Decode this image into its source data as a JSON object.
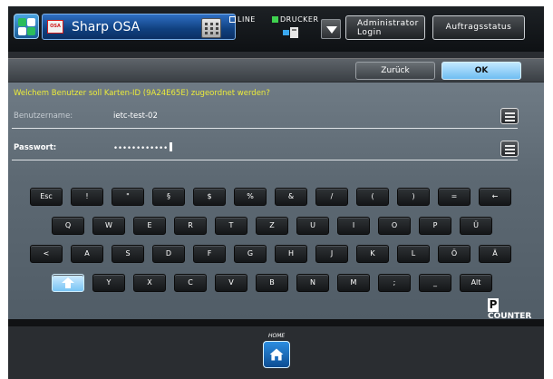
{
  "header": {
    "app_title": "Sharp OSA",
    "osa_badge": "OSA",
    "status_line": "LINE",
    "status_printer": "DRUCKER",
    "admin_button": [
      "Administrator",
      "Login"
    ],
    "job_status_button": "Auftragsstatus"
  },
  "toolbar": {
    "back_label": "Zurück",
    "ok_label": "OK"
  },
  "form": {
    "question": "Welchem Benutzer soll Karten-ID (9A24E65E) zugeordnet werden?",
    "username_label": "Benutzername:",
    "username_value": "ietc-test-02",
    "password_label": "Passwort:",
    "password_value": "••••••••••••"
  },
  "keyboard": {
    "rows": [
      [
        "Esc",
        "!",
        "\"",
        "§",
        "$",
        "%",
        "&",
        "/",
        "(",
        ")",
        "=",
        "←"
      ],
      [
        "Q",
        "W",
        "E",
        "R",
        "T",
        "Z",
        "U",
        "I",
        "O",
        "P",
        "Ü"
      ],
      [
        "<",
        "A",
        "S",
        "D",
        "F",
        "G",
        "H",
        "J",
        "K",
        "L",
        "Ö",
        "Ä"
      ],
      [
        "shift",
        "Y",
        "X",
        "C",
        "V",
        "B",
        "N",
        "M",
        ";",
        "_",
        "Alt"
      ]
    ]
  },
  "brand": {
    "logo_letter": "P",
    "logo_text": "COUNTER"
  },
  "footer": {
    "home_label": "HOME"
  },
  "colors": {
    "accent_blue": "#78c4f4",
    "question_yellow": "#ecec3a",
    "panel_gray": "#5d6973"
  },
  "icons": {
    "app": "app-grid-icon",
    "keypad": "keypad-icon",
    "printer": "printer-icon",
    "dropdown": "triangle-down-icon",
    "keyboard": "keyboard-icon",
    "shift": "shift-arrow-icon",
    "home": "home-icon"
  }
}
